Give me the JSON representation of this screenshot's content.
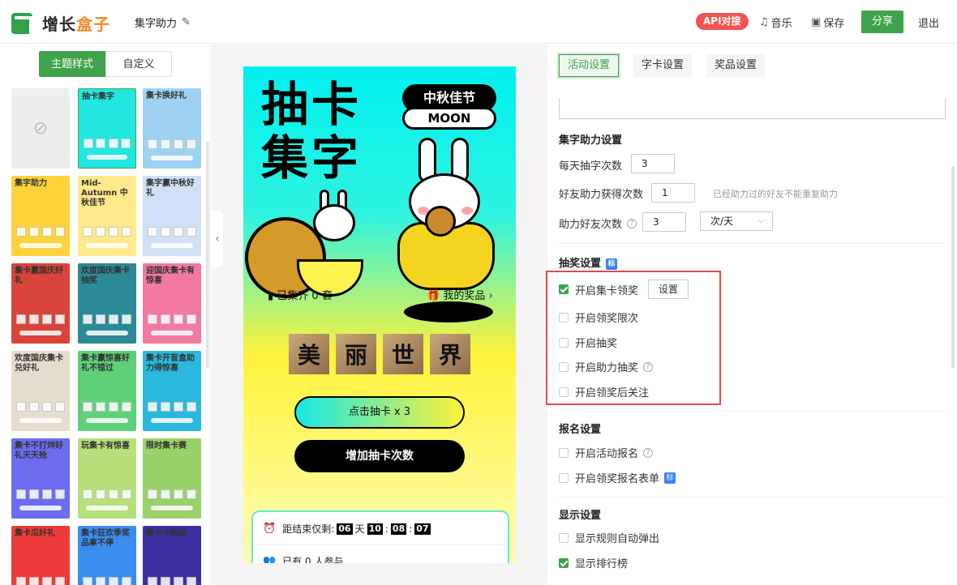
{
  "header": {
    "logo_text_main": "增长",
    "logo_text_accent": "盒子",
    "project_title": "集字助力",
    "api_badge": "API对接",
    "music_label": "音乐",
    "save_label": "保存",
    "share_label": "分享",
    "exit_label": "退出"
  },
  "left": {
    "tab_theme": "主题样式",
    "tab_custom": "自定义",
    "none_symbol": "⊘",
    "templates": [
      {
        "title": "",
        "bg": "#eeeeee"
      },
      {
        "title": "抽卡集字",
        "bg": "#22e6e0"
      },
      {
        "title": "集卡换好礼",
        "bg": "#9fd2f2"
      },
      {
        "title": "集字助力",
        "bg": "#ffd23a"
      },
      {
        "title": "Mid-Autumn 中秋佳节",
        "bg": "#ffe98a"
      },
      {
        "title": "集字赢中秋好礼",
        "bg": "#cfe0f7"
      },
      {
        "title": "集卡赢国庆好礼",
        "bg": "#d9443a"
      },
      {
        "title": "欢度国庆集卡抽奖",
        "bg": "#2c8a96"
      },
      {
        "title": "迎国庆集卡有惊喜",
        "bg": "#f27aa0"
      },
      {
        "title": "欢度国庆集卡兑好礼",
        "bg": "#e6dccd"
      },
      {
        "title": "集卡赢惊喜好礼不错过",
        "bg": "#5fd07a"
      },
      {
        "title": "集卡开盲盒助力得惊喜",
        "bg": "#2ab8dc"
      },
      {
        "title": "集卡不打烊好礼天天抢",
        "bg": "#6b6cf0"
      },
      {
        "title": "玩集卡有惊喜",
        "bg": "#b6e07a"
      },
      {
        "title": "限时集卡赛",
        "bg": "#9ad26a"
      },
      {
        "title": "集卡瓜好礼",
        "bg": "#ef3a3a"
      },
      {
        "title": "集卡狂欢季奖品拿不停",
        "bg": "#3a8ef0"
      },
      {
        "title": "集卡冲刺战",
        "bg": "#3d2fa0"
      }
    ]
  },
  "preview": {
    "title_line1": "抽卡",
    "title_line2": "集字",
    "badge_mid": "中秋佳节",
    "badge_moon": "MOON",
    "collected_label": "已集齐 0 套",
    "my_prize_label": "我的奖品 ›",
    "chars": [
      "美",
      "丽",
      "世",
      "界"
    ],
    "draw_button": "点击抽卡 x 3",
    "add_button": "增加抽卡次数",
    "countdown_label": "距结束仅剩:",
    "countdown_days": "06",
    "countdown_day_unit": "天",
    "countdown_hours": "10",
    "countdown_minutes": "08",
    "countdown_seconds": "07",
    "colon": ":",
    "participants_label": "已有 0 人参与"
  },
  "settings": {
    "tab_activity": "活动设置",
    "tab_card": "字卡设置",
    "tab_prize": "奖品设置",
    "section_help": "集字助力设置",
    "daily_draws_label": "每天抽字次数",
    "daily_draws_value": "3",
    "friend_help_label": "好友助力获得次数",
    "friend_help_value": "1",
    "friend_help_hint": "已经助力过的好友不能重复助力",
    "help_friends_label": "助力好友次数",
    "help_friends_value": "3",
    "help_friends_unit": "次/天",
    "section_lottery": "抽奖设置",
    "section_lottery_tag": "标",
    "opt_collect_reward": "开启集卡领奖",
    "opt_collect_reward_btn": "设置",
    "opt_reward_limit": "开启领奖限次",
    "opt_lottery": "开启抽奖",
    "opt_help_lottery": "开启助力抽奖",
    "opt_follow_after": "开启领奖后关注",
    "section_signup": "报名设置",
    "opt_activity_signup": "开启活动报名",
    "opt_reward_form": "开启领奖报名表单",
    "opt_reward_form_tag": "标",
    "section_display": "显示设置",
    "opt_rules_popup": "显示规则自动弹出",
    "opt_leaderboard": "显示排行榜"
  },
  "colors": {
    "brand_green": "#3fa34d",
    "api_red": "#f25353",
    "highlight_red": "#e24a4a"
  }
}
